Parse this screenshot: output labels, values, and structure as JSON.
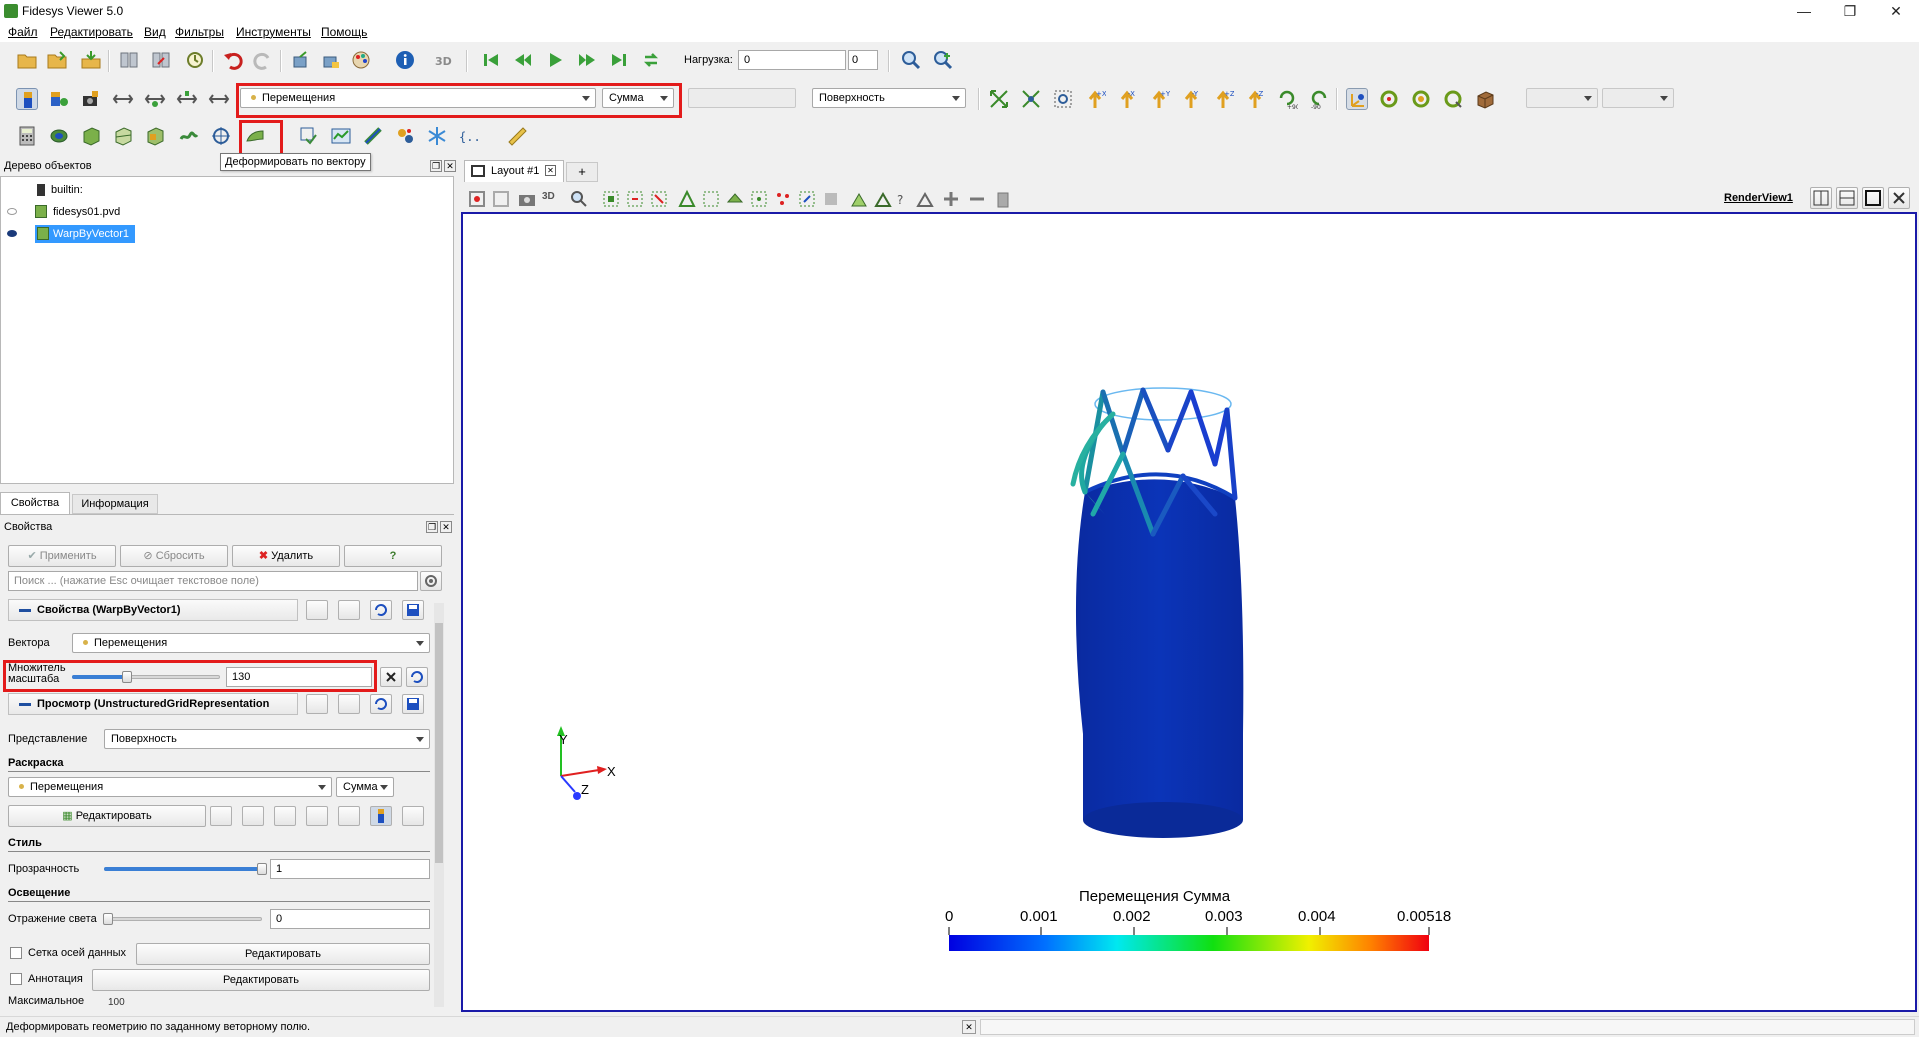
{
  "window": {
    "title": "Fidesys Viewer 5.0",
    "minimize": "—",
    "maximize": "❐",
    "close": "✕"
  },
  "menu": [
    "Файл",
    "Редактировать",
    "Вид",
    "Фильтры",
    "Инструменты",
    "Помощь"
  ],
  "toolbar1": {
    "load_label": "Нагрузка:",
    "load_value": "0",
    "load_spin_value": "0"
  },
  "toolbar2": {
    "array_combo": "Перемещения",
    "component_combo": "Сумма",
    "representation_combo": "Поверхность"
  },
  "tooltip": "Деформировать по вектору",
  "pipeline": {
    "title": "Дерево объектов",
    "items": [
      {
        "label": "builtin:"
      },
      {
        "label": "fidesys01.pvd"
      },
      {
        "label": "WarpByVector1"
      }
    ]
  },
  "tabs": {
    "properties": "Свойства",
    "info": "Информация"
  },
  "properties": {
    "title": "Свойства",
    "apply": "Применить",
    "reset": "Сбросить",
    "delete": "Удалить",
    "help": "?",
    "search_placeholder": "Поиск ... (нажатие Esc очищает текстовое поле)",
    "section_filter": "Свойства (WarpByVector1)",
    "vectors_label": "Вектора",
    "vectors_value": "Перемещения",
    "scale_label_1": "Множитель",
    "scale_label_2": "масштаба",
    "scale_value": "130",
    "scale_slider_fraction": 0.37,
    "section_display": "Просмотр (UnstructuredGridRepresentation",
    "representation_label": "Представление",
    "representation_value": "Поверхность",
    "coloring_label": "Раскраска",
    "coloring_array": "Перемещения",
    "coloring_component": "Сумма",
    "edit_button": "Редактировать",
    "style_label": "Стиль",
    "opacity_label": "Прозрачность",
    "opacity_value": "1",
    "opacity_fraction": 1.0,
    "lighting_label": "Освещение",
    "specular_label": "Отражение света",
    "specular_value": "0",
    "specular_fraction": 0.0,
    "axes_grid_label": "Сетка осей данных",
    "axes_grid_edit": "Редактировать",
    "annotation_label": "Аннотация",
    "annotation_edit": "Редактировать",
    "max_label": "Максимальное",
    "max_value": "100"
  },
  "layout": {
    "tab_label": "Layout #1",
    "add_tab": "+",
    "view_name": "RenderView1",
    "button_3d": "3D"
  },
  "scalar_bar": {
    "title": "Перемещения Сумма",
    "ticks": [
      "0",
      "0.001",
      "0.002",
      "0.003",
      "0.004",
      "0.00518"
    ]
  },
  "axes": {
    "x": "X",
    "y": "Y",
    "z": "Z"
  },
  "status": {
    "text": "Деформировать геометрию по заданному веторному полю."
  },
  "colors": {
    "highlight": "#e31b1b",
    "selection": "#3399ff",
    "render_border": "#1a1aa8",
    "model": "#0b2ea8"
  }
}
